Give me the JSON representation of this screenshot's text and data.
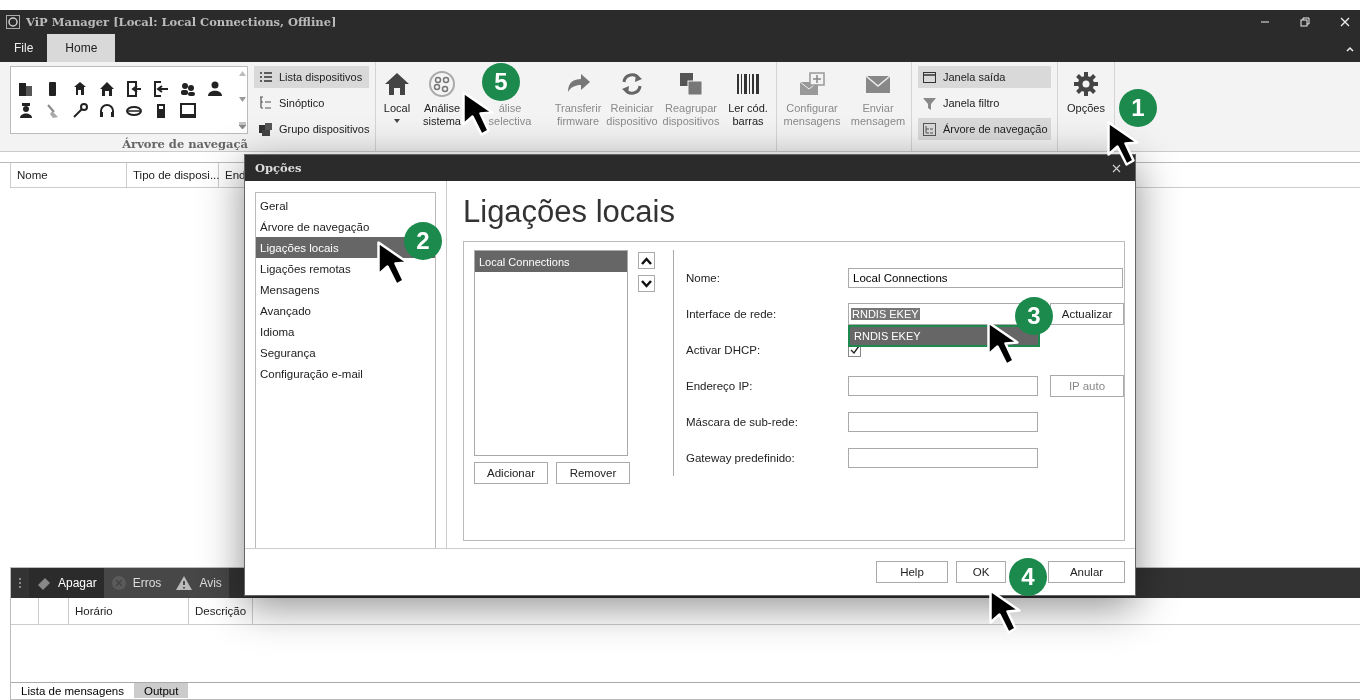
{
  "window": {
    "title": "ViP Manager [Local: Local Connections, Offline]"
  },
  "menu_tabs": [
    {
      "label": "File",
      "selected": false
    },
    {
      "label": "Home",
      "selected": true
    }
  ],
  "ribbon": {
    "gallery_label": "Árvore de navegaçã",
    "layout_items": [
      {
        "label": "Lista dispositivos",
        "selected": true
      },
      {
        "label": "Sinóptico",
        "selected": false
      },
      {
        "label": "Grupo dispositivos",
        "selected": false
      }
    ],
    "action_buttons": [
      {
        "label": "Local",
        "disabled": false,
        "dropdown": true
      },
      {
        "label": "Análise\nsistema",
        "disabled": false,
        "dropdown": false
      },
      {
        "label": "álise\nselectiva",
        "disabled": true,
        "dropdown": false
      },
      {
        "label": "Transferir\nfirmware",
        "disabled": true,
        "dropdown": false
      },
      {
        "label": "Reiniciar\ndispositivo",
        "disabled": true,
        "dropdown": false
      },
      {
        "label": "Reagrupar\ndispositivos",
        "disabled": true,
        "dropdown": false
      },
      {
        "label": "Ler cód.\nbarras",
        "disabled": false,
        "dropdown": false
      }
    ],
    "message_buttons": [
      {
        "label": "Configurar\nmensagens",
        "disabled": true
      },
      {
        "label": "Enviar\nmensagem",
        "disabled": true
      }
    ],
    "view_items": [
      {
        "label": "Janela saída",
        "selected": true
      },
      {
        "label": "Janela filtro",
        "selected": false
      },
      {
        "label": "Árvore de navegação",
        "selected": true
      }
    ],
    "options_button": "Opções"
  },
  "navigation_table": {
    "columns": [
      "Nome",
      "Tipo de disposi...",
      "End"
    ]
  },
  "messages_panel": {
    "toolbar": [
      {
        "label": "Apagar",
        "selected": true
      },
      {
        "label": "Erros",
        "selected": false
      },
      {
        "label": "Avis",
        "selected": false
      }
    ],
    "columns": [
      "Horário",
      "Descrição"
    ],
    "tabs": [
      {
        "label": "Lista de mensagens",
        "selected": true
      },
      {
        "label": "Output",
        "selected": false
      }
    ]
  },
  "dialog": {
    "title": "Opções",
    "categories": [
      {
        "label": "Geral",
        "selected": false
      },
      {
        "label": "Árvore de navegação",
        "selected": false
      },
      {
        "label": "Ligações locais",
        "selected": true
      },
      {
        "label": "Ligações remotas",
        "selected": false
      },
      {
        "label": "Mensagens",
        "selected": false
      },
      {
        "label": "Avançado",
        "selected": false
      },
      {
        "label": "Idioma",
        "selected": false
      },
      {
        "label": "Segurança",
        "selected": false
      },
      {
        "label": "Configuração e-mail",
        "selected": false
      }
    ],
    "heading": "Ligações locais",
    "connections": [
      {
        "label": "Local Connections",
        "selected": true
      }
    ],
    "list_buttons": [
      "Adicionar",
      "Remover"
    ],
    "form": {
      "name": {
        "label": "Nome:",
        "value": "Local Connections"
      },
      "interface": {
        "label": "Interface de rede:",
        "value": "RNDIS EKEY",
        "expanded": true,
        "options": [
          {
            "label": "RNDIS EKEY",
            "selected": true
          }
        ],
        "button": "Actualizar"
      },
      "dhcp": {
        "label": "Activar DHCP:",
        "checked": true
      },
      "ip": {
        "label": "Endereço IP:",
        "button": "IP auto",
        "button_disabled": true
      },
      "mask": {
        "label": "Máscara de sub-rede:"
      },
      "gateway": {
        "label": "Gateway predefinido:"
      }
    },
    "buttons": [
      "Help",
      "OK",
      "Anular"
    ]
  },
  "callouts": [
    {
      "label": "1"
    },
    {
      "label": "2"
    },
    {
      "label": "3"
    },
    {
      "label": "4"
    },
    {
      "label": "5"
    }
  ]
}
